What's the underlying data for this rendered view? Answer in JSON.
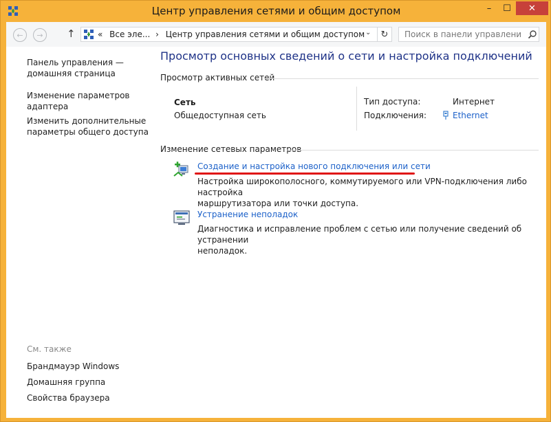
{
  "window": {
    "title": "Центр управления сетями и общим доступом",
    "min_glyph": "–",
    "max_glyph": "☐",
    "close_glyph": "✕"
  },
  "nav": {
    "back_glyph": "←",
    "forward_glyph": "→",
    "up_glyph": "↑",
    "address_prefix": "«",
    "address_crumb1": "Все эле...",
    "address_sep": "›",
    "address_crumb2": "Центр управления сетями и общим доступом",
    "dropdown_glyph": "⌄",
    "refresh_glyph": "↻",
    "search_placeholder": "Поиск в панели управления"
  },
  "sidebar": {
    "items": [
      {
        "label_line1": "Панель управления —",
        "label_line2": "домашняя страница"
      },
      {
        "label_line1": "Изменение параметров",
        "label_line2": "адаптера"
      },
      {
        "label_line1": "Изменить дополнительные",
        "label_line2": "параметры общего доступа"
      }
    ],
    "see_also": "См. также",
    "see_also_items": [
      {
        "label": "Брандмауэр Windows"
      },
      {
        "label": "Домашняя группа"
      },
      {
        "label": "Свойства браузера"
      }
    ]
  },
  "main": {
    "heading": "Просмотр основных сведений о сети и настройка подключений",
    "active_section": "Просмотр активных сетей",
    "network_name": "Сеть",
    "network_type": "Общедоступная сеть",
    "access_label": "Тип доступа:",
    "access_value": "Интернет",
    "connections_label": "Подключения:",
    "connections_value": "Ethernet",
    "change_section": "Изменение сетевых параметров",
    "tasks": [
      {
        "link": "Создание и настройка нового подключения или сети",
        "desc_line1": "Настройка широкополосного, коммутируемого или VPN-подключения либо настройка",
        "desc_line2": "маршрутизатора или точки доступа."
      },
      {
        "link": "Устранение неполадок",
        "desc_line1": "Диагностика и исправление проблем с сетью или получение сведений об устранении",
        "desc_line2": "неполадок."
      }
    ]
  },
  "colors": {
    "frame": "#f6b23a",
    "close_button": "#c7413a",
    "heading": "#1e3287",
    "link": "#1c61c9",
    "annotation_underline": "#e01010"
  }
}
